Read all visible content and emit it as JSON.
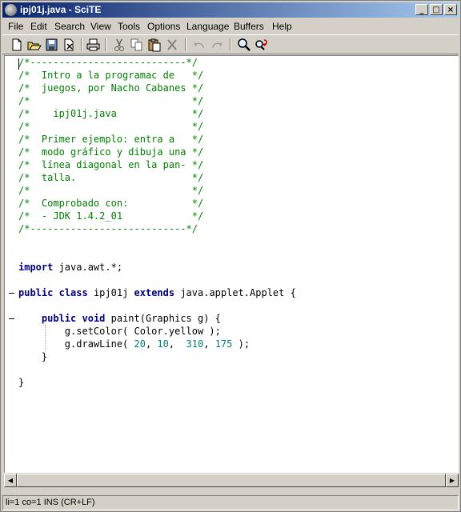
{
  "window": {
    "title": "ipj01j.java - SciTE"
  },
  "menu": [
    "File",
    "Edit",
    "Search",
    "View",
    "Tools",
    "Options",
    "Language",
    "Buffers",
    "Help"
  ],
  "toolbar": {
    "buttons": [
      "new-file-icon",
      "open-folder-icon",
      "save-icon",
      "close-file-icon",
      "print-icon",
      "cut-icon",
      "copy-icon",
      "paste-icon",
      "delete-icon",
      "undo-icon",
      "redo-icon",
      "find-icon",
      "replace-icon"
    ]
  },
  "editor": {
    "lines": [
      [
        {
          "t": "/*---------------------------*/",
          "c": "cm"
        }
      ],
      [
        {
          "t": "/*  Intro a la programac de   */",
          "c": "cm"
        }
      ],
      [
        {
          "t": "/*  juegos, por Nacho Cabanes */",
          "c": "cm"
        }
      ],
      [
        {
          "t": "/*                            */",
          "c": "cm"
        }
      ],
      [
        {
          "t": "/*    ipj01j.java             */",
          "c": "cm"
        }
      ],
      [
        {
          "t": "/*                            */",
          "c": "cm"
        }
      ],
      [
        {
          "t": "/*  Primer ejemplo: entra a   */",
          "c": "cm"
        }
      ],
      [
        {
          "t": "/*  modo gráfico y dibuja una */",
          "c": "cm"
        }
      ],
      [
        {
          "t": "/*  línea diagonal en la pan- */",
          "c": "cm"
        }
      ],
      [
        {
          "t": "/*  talla.                    */",
          "c": "cm"
        }
      ],
      [
        {
          "t": "/*                            */",
          "c": "cm"
        }
      ],
      [
        {
          "t": "/*  Comprobado con:           */",
          "c": "cm"
        }
      ],
      [
        {
          "t": "/*  - JDK 1.4.2_01            */",
          "c": "cm"
        }
      ],
      [
        {
          "t": "/*---------------------------*/",
          "c": "cm"
        }
      ],
      [],
      [],
      [
        {
          "t": "import",
          "c": "kw"
        },
        {
          "t": " java.awt.*;"
        }
      ],
      [],
      [
        {
          "t": "public",
          "c": "kw"
        },
        {
          "t": " "
        },
        {
          "t": "class",
          "c": "kw"
        },
        {
          "t": " ipj01j "
        },
        {
          "t": "extends",
          "c": "kw"
        },
        {
          "t": " java.applet.Applet {"
        }
      ],
      [],
      [
        {
          "t": "    "
        },
        {
          "t": "public",
          "c": "kw"
        },
        {
          "t": " "
        },
        {
          "t": "void",
          "c": "kw"
        },
        {
          "t": " paint(Graphics g) {"
        }
      ],
      [
        {
          "t": "        g.setColor( Color.yellow );"
        }
      ],
      [
        {
          "t": "        g.drawLine( "
        },
        {
          "t": "20",
          "c": "num"
        },
        {
          "t": ", "
        },
        {
          "t": "10",
          "c": "num"
        },
        {
          "t": ",  "
        },
        {
          "t": "310",
          "c": "num"
        },
        {
          "t": ", "
        },
        {
          "t": "175",
          "c": "num"
        },
        {
          "t": " );"
        }
      ],
      [
        {
          "t": "    }"
        }
      ],
      [],
      [
        {
          "t": "}"
        }
      ]
    ]
  },
  "status": {
    "text": "li=1 co=1 INS (CR+LF)"
  }
}
